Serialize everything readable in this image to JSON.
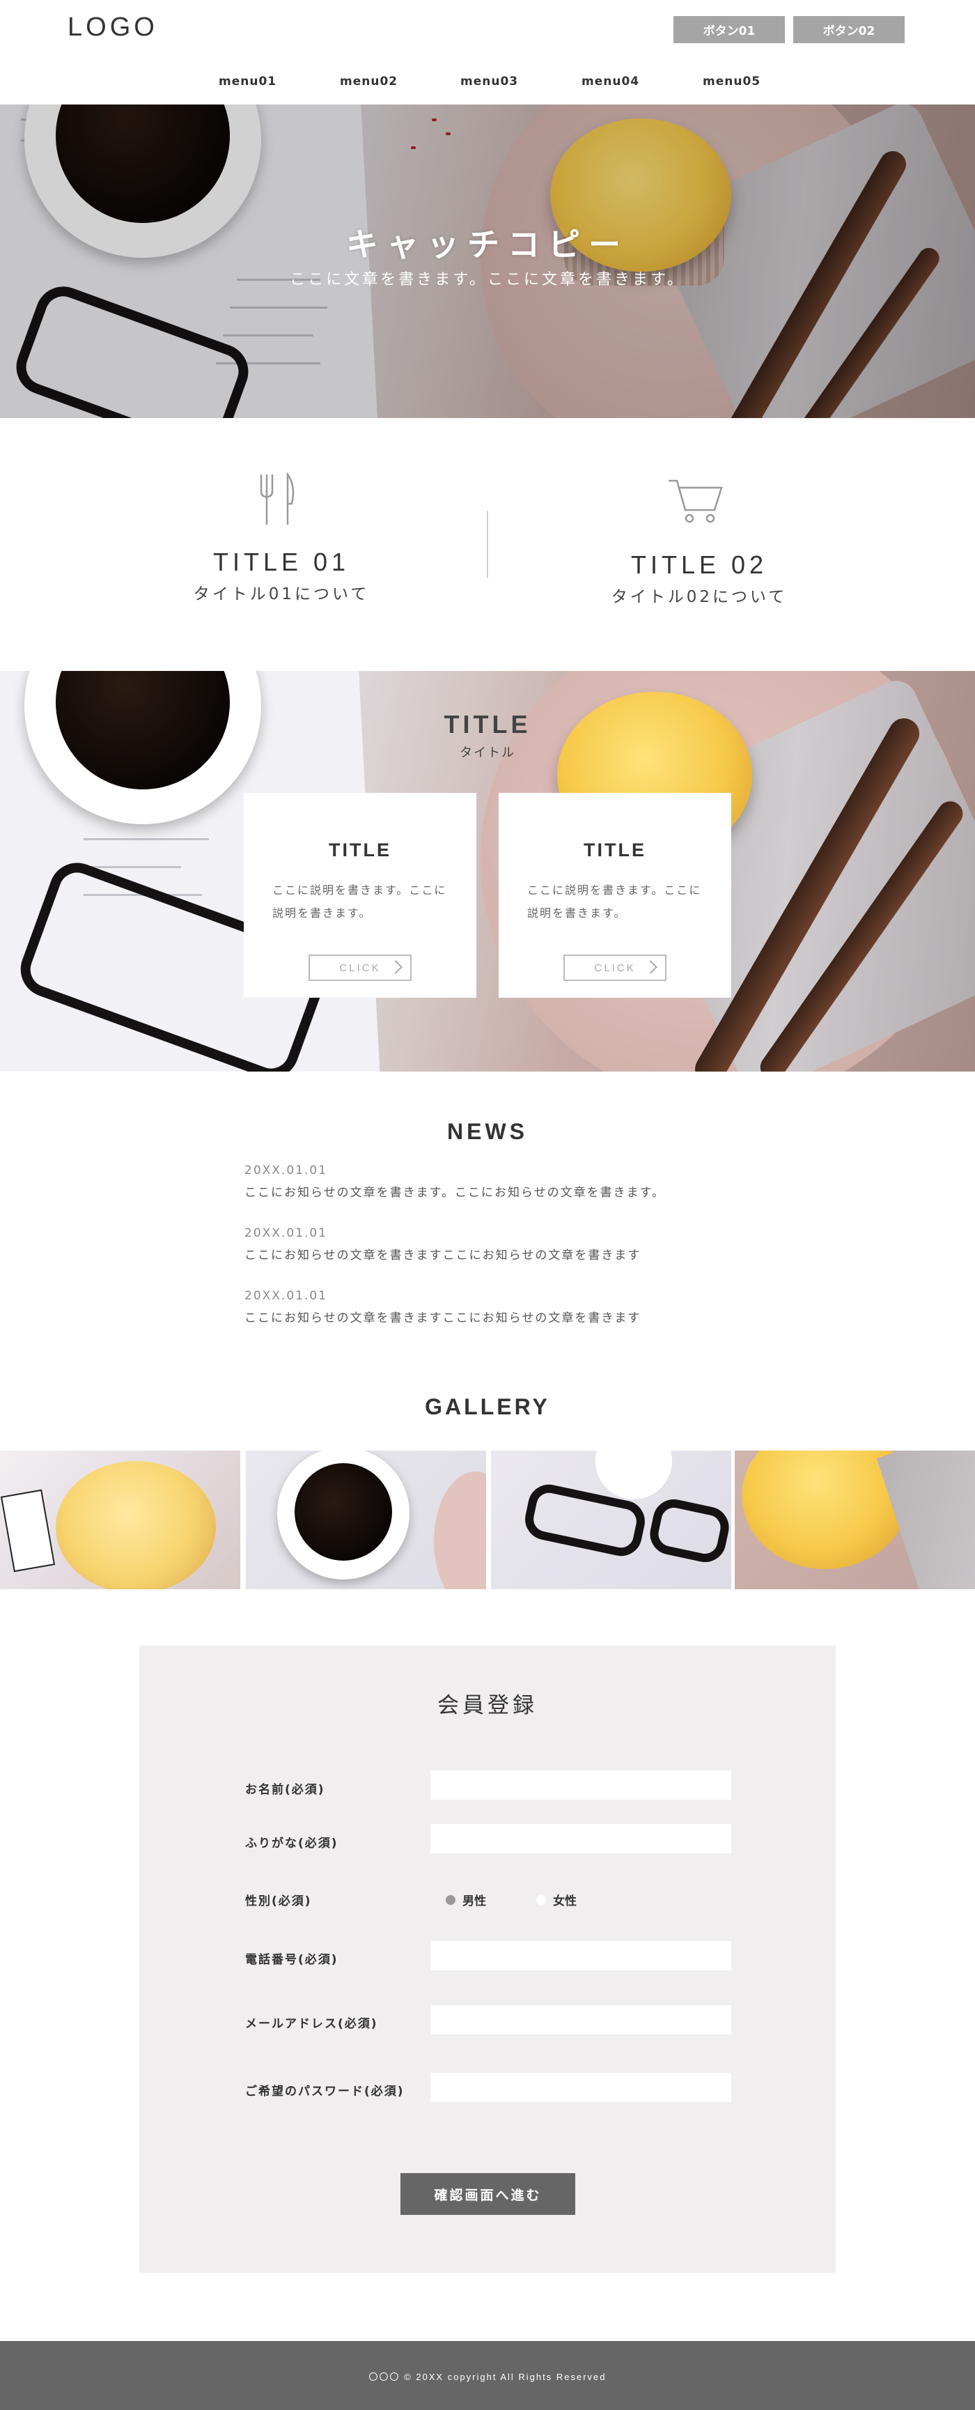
{
  "header": {
    "logo": "LOGO",
    "button1": "ボタン01",
    "button2": "ボタン02",
    "menu": [
      "menu01",
      "menu02",
      "menu03",
      "menu04",
      "menu05"
    ]
  },
  "hero": {
    "catch": "キャッチコピー",
    "sub": "ここに文章を書きます。ここに文章を書きます。"
  },
  "features": [
    {
      "icon": "cutlery-icon",
      "title": "TITLE 01",
      "sub": "タイトル01について"
    },
    {
      "icon": "cart-icon",
      "title": "TITLE 02",
      "sub": "タイトル02について"
    }
  ],
  "cards_section": {
    "title": "TITLE",
    "sub": "タイトル",
    "cards": [
      {
        "title": "TITLE",
        "text": "ここに説明を書きます。ここに説明を書きます。",
        "button": "CLICK"
      },
      {
        "title": "TITLE",
        "text": "ここに説明を書きます。ここに説明を書きます。",
        "button": "CLICK"
      }
    ]
  },
  "news": {
    "title": "NEWS",
    "items": [
      {
        "date": "20XX.01.01",
        "text": "ここにお知らせの文章を書きます。ここにお知らせの文章を書きます。"
      },
      {
        "date": "20XX.01.01",
        "text": "ここにお知らせの文章を書きますここにお知らせの文章を書きます"
      },
      {
        "date": "20XX.01.01",
        "text": "ここにお知らせの文章を書きますここにお知らせの文章を書きます"
      }
    ]
  },
  "gallery": {
    "title": "GALLERY"
  },
  "form": {
    "title": "会員登録",
    "name_label": "お名前(必須)",
    "kana_label": "ふりがな(必須)",
    "gender_label": "性別(必須)",
    "gender_options": [
      "男性",
      "女性"
    ],
    "phone_label": "電話番号(必須)",
    "email_label": "メールアドレス(必須)",
    "password_label": "ご希望のパスワード(必須)",
    "submit": "確認画面へ進む"
  },
  "footer": {
    "copyright": "〇〇〇 © 20XX copyright All Rights Reserved"
  }
}
